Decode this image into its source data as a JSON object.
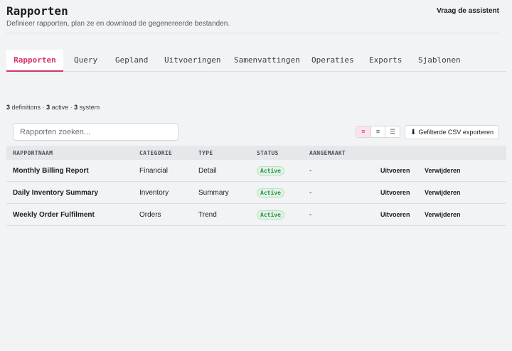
{
  "header": {
    "title": "Rapporten",
    "subtitle": "Definieer rapporten, plan ze en download de gegenereerde bestanden.",
    "assistant_label": "Vraag de assistent"
  },
  "tabs": [
    {
      "label": "Rapporten",
      "active": true
    },
    {
      "label": "Query",
      "active": false
    },
    {
      "label": "Gepland",
      "active": false
    },
    {
      "label": "Uitvoeringen",
      "active": false
    },
    {
      "label": "Samenvattingen",
      "active": false
    },
    {
      "label": "Operaties",
      "active": false
    },
    {
      "label": "Exports",
      "active": false
    },
    {
      "label": "Sjablonen",
      "active": false
    }
  ],
  "summary": {
    "definitions_count": "3",
    "definitions_label": "definitions ·",
    "active_count": "3",
    "active_label": "active ·",
    "system_count": "3",
    "system_label": "system"
  },
  "search": {
    "placeholder": "Rapporten zoeken...",
    "value": ""
  },
  "view_toggle": {
    "options": [
      "≡",
      "≡",
      "☰"
    ],
    "selected": 0
  },
  "export": {
    "icon": "download-icon",
    "label": "Gefilterde CSV exporteren"
  },
  "table": {
    "columns": [
      "RAPPORTNAAM",
      "CATEGORIE",
      "TYPE",
      "STATUS",
      "AANGEMAAKT"
    ],
    "rows": [
      {
        "name": "Monthly Billing Report",
        "category": "Financial",
        "type": "Detail",
        "status": "Active",
        "created": "-",
        "run": "Uitvoeren",
        "delete": "Verwijderen"
      },
      {
        "name": "Daily Inventory Summary",
        "category": "Inventory",
        "type": "Summary",
        "status": "Active",
        "created": "-",
        "run": "Uitvoeren",
        "delete": "Verwijderen"
      },
      {
        "name": "Weekly Order Fulfilment",
        "category": "Orders",
        "type": "Trend",
        "status": "Active",
        "created": "-",
        "run": "Uitvoeren",
        "delete": "Verwijderen"
      }
    ]
  },
  "colors": {
    "accent": "#d6336c",
    "status_active": "#2f8a4b",
    "background": "#f2f3f5"
  }
}
